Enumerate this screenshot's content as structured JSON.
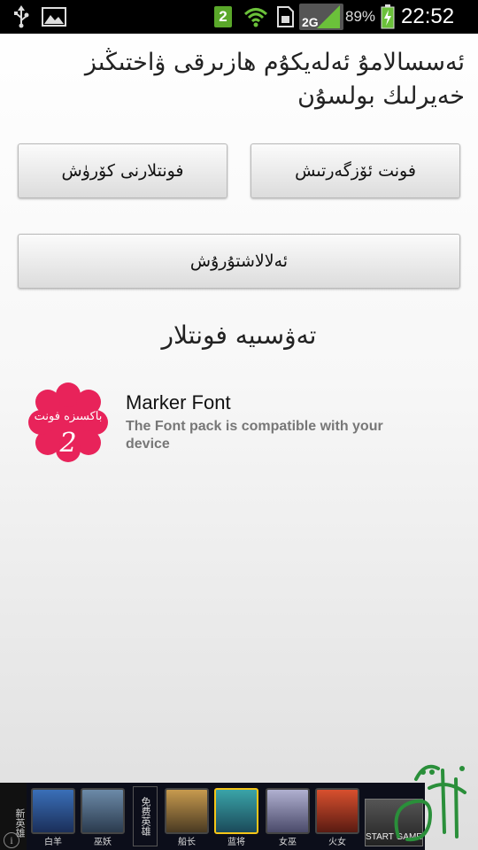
{
  "status_bar": {
    "network_badge": "2",
    "network_type": "2G",
    "battery_percent": "89%",
    "time": "22:52",
    "icons": [
      "usb-icon",
      "gallery-icon",
      "notification-badge",
      "wifi-icon",
      "sim-icon",
      "signal-icon",
      "battery-icon"
    ]
  },
  "header": {
    "title": "ئەسسالامۇ ئەلەيكۇم ھازىرقى ۋاختىڭىز خەيرلىك بولسۇن"
  },
  "buttons": {
    "change_font": "فونت ئۆزگەرتىش",
    "font_list": "فونتلارنى كۆرۈش",
    "about": "ئەلالاشتۇرۇش"
  },
  "section": {
    "title": "تەۋسىيە فونتلار"
  },
  "font_item": {
    "thumb_text": "باكسىزە فونت",
    "thumb_number": "2",
    "name": "Marker Font",
    "description": "The Font pack is compatible with your device"
  },
  "ad": {
    "side_text": "新英雄",
    "heroes": [
      "白羊",
      "巫妖",
      "船长",
      "蓝将",
      "女巫",
      "火女"
    ],
    "heroes_header": "免费英雄",
    "start_label": "START GAME",
    "info_symbol": "i"
  },
  "colors": {
    "status_bar_bg": "#000000",
    "badge_green": "#5aa82a",
    "thumb_pink": "#e8235a",
    "watermark_green": "#2a8f3a"
  }
}
